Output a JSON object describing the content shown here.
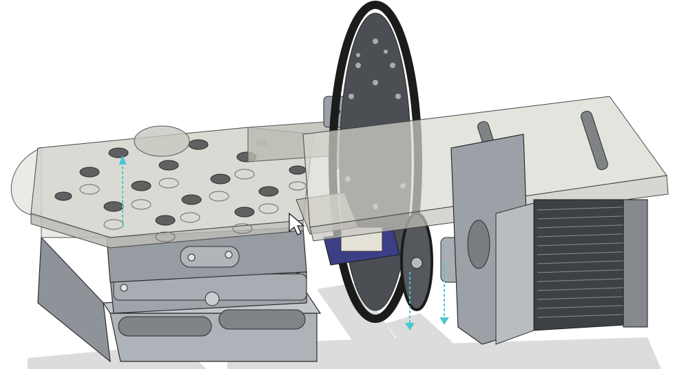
{
  "viewport": {
    "background": "#ffffff",
    "cursor": "arrow-cursor"
  },
  "model": {
    "components": [
      "xy-stage",
      "top-plate",
      "belt-pulley-wheel",
      "stepper-motor",
      "shaft-coupler",
      "circuit-board",
      "motor-mount-bracket"
    ],
    "engraving_text": "64"
  },
  "colors": {
    "metal_light": "#b9bec4",
    "metal_dark": "#5d6166",
    "glass": "#d8d9d4",
    "edge": "#2b2b2b",
    "belt": "#1b1b1b",
    "pcb": "#3c3f86",
    "axis_marker": "#48c7d4"
  }
}
